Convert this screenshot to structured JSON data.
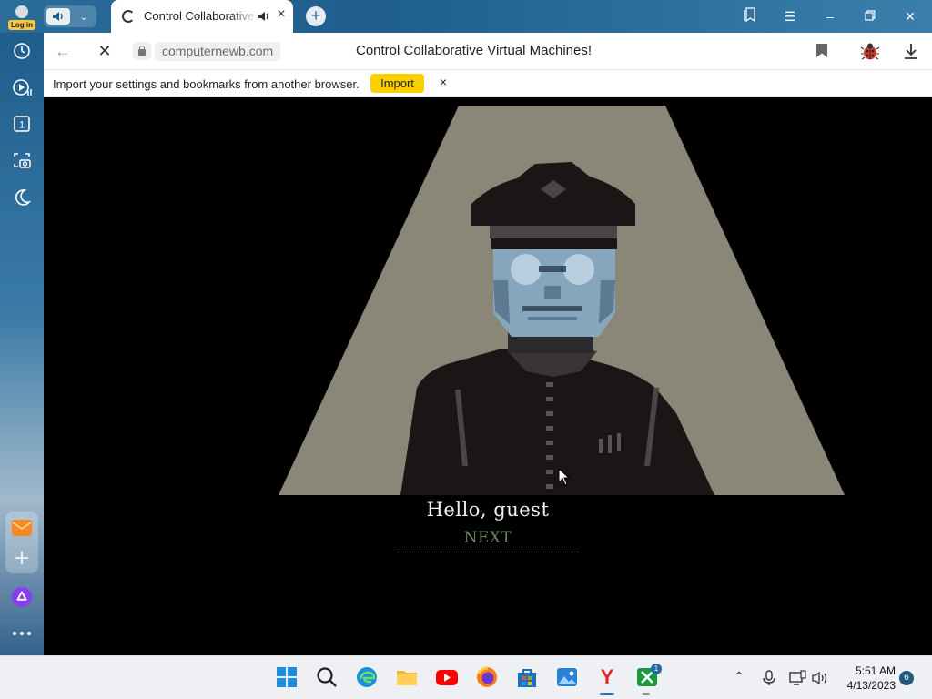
{
  "browser": {
    "login_label": "Log in",
    "tab": {
      "title": "Control Collaborative Virtual Machines!"
    },
    "address": {
      "domain": "computernewb.com",
      "page_title": "Control Collaborative Virtual Machines!"
    },
    "infobar": {
      "message": "Import your settings and bookmarks from another browser.",
      "import_label": "Import",
      "close_glyph": "×"
    },
    "window_controls": [
      "collections-icon",
      "menu-icon",
      "minimize-icon",
      "restore-icon",
      "close-icon"
    ],
    "sidebar_icons": [
      "history-icon",
      "video-icon",
      "counter-icon",
      "screenshot-icon",
      "night-mode-icon",
      "mail-icon",
      "add-icon",
      "alice-icon",
      "more-icon"
    ],
    "sidebar_counter": "1"
  },
  "game": {
    "greeting": "Hello, guest",
    "next_label": "NEXT",
    "colors": {
      "spotlight": "#8b8778",
      "uniform": "#1b1616",
      "face": "#86a6bd",
      "next": "#6d8560"
    }
  },
  "taskbar": {
    "apps": [
      "windows-start-icon",
      "search-icon",
      "edge-icon",
      "file-explorer-icon",
      "youtube-icon",
      "firefox-icon",
      "store-icon",
      "photos-icon",
      "yandex-browser-icon",
      "xbox-icon"
    ],
    "xbox_badge": "1",
    "time": "5:51 AM",
    "date": "4/13/2023",
    "notifications": "6"
  }
}
